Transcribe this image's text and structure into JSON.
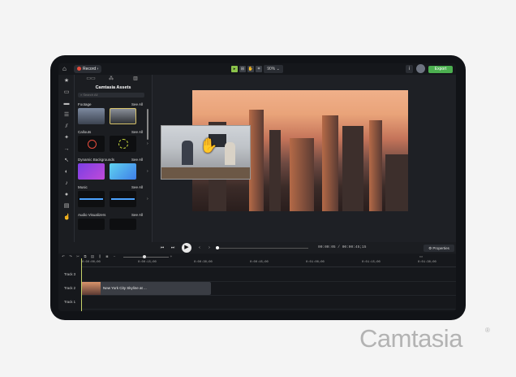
{
  "topbar": {
    "home_icon": "home-icon",
    "record_label": "Record",
    "zoom": "90%",
    "export_label": "Export"
  },
  "assets": {
    "title": "Camtasia Assets",
    "search_placeholder": "Search All",
    "sections": [
      {
        "title": "Footage",
        "see_all": "See All"
      },
      {
        "title": "Callouts",
        "see_all": "See All"
      },
      {
        "title": "Dynamic Backgrounds",
        "see_all": "See All"
      },
      {
        "title": "Music",
        "see_all": "See All"
      },
      {
        "title": "Audio Visualizers",
        "see_all": "See All"
      }
    ]
  },
  "playback": {
    "timecode": "00:00:05 / 00:00:45;15",
    "properties_label": "Properties"
  },
  "timeline": {
    "ruler": [
      "0:00:00;00",
      "0:00:15;00",
      "0:00:30;00",
      "0:00:45;00",
      "0:01:00;00",
      "0:01:15;00",
      "0:01:30;00"
    ],
    "tracks": [
      "Track 3",
      "Track 2",
      "Track 1"
    ],
    "clip_label": "New York City Skyline at ..."
  },
  "brand": {
    "name": "Camtasia",
    "reg": "®"
  },
  "colors": {
    "export": "#4caf50",
    "playhead": "#c7d36a",
    "record_dot": "#e74c3c"
  }
}
